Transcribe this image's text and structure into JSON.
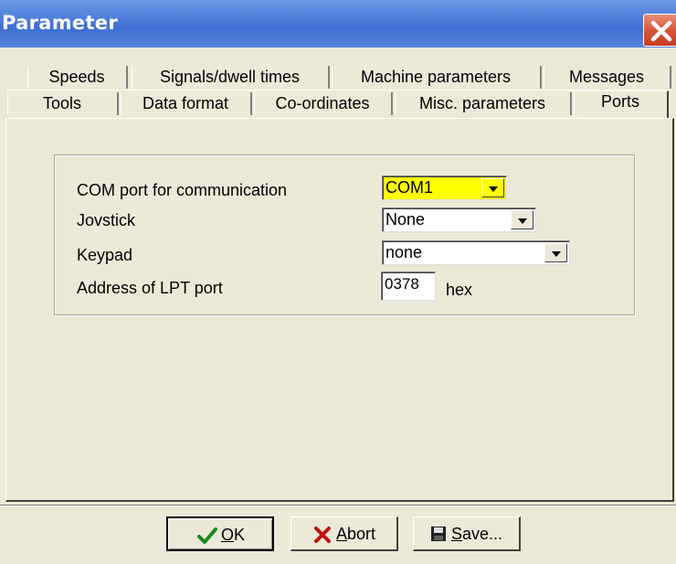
{
  "window": {
    "title": "Parameter",
    "close_icon": "close-icon"
  },
  "tabs": {
    "row1": [
      "Speeds",
      "Signals/dwell times",
      "Machine parameters",
      "Messages"
    ],
    "row2": [
      "Tools",
      "Data format",
      "Co-ordinates",
      "Misc. parameters",
      "Ports"
    ],
    "selected": "Ports"
  },
  "ports": {
    "com_label": "COM port for communication",
    "com_value": "COM1",
    "joystick_label": "Jovstick",
    "joystick_value": "None",
    "keypad_label": "Keypad",
    "keypad_value": "none",
    "lpt_label": "Address of LPT port",
    "lpt_value": "0378",
    "lpt_unit": "hex"
  },
  "buttons": {
    "ok_rest": "K",
    "ok_mnemonic": "O",
    "ok_icon": "check-icon",
    "abort_rest": "bort",
    "abort_mnemonic": "A",
    "abort_icon": "x-icon",
    "save_rest": "ave...",
    "save_mnemonic": "S",
    "save_icon": "floppy-disk-icon"
  },
  "colors": {
    "titlebar": "#3e6fd3",
    "highlight": "#ffff00",
    "dialog_bg": "#ece9d8",
    "close_red": "#d7553a"
  }
}
